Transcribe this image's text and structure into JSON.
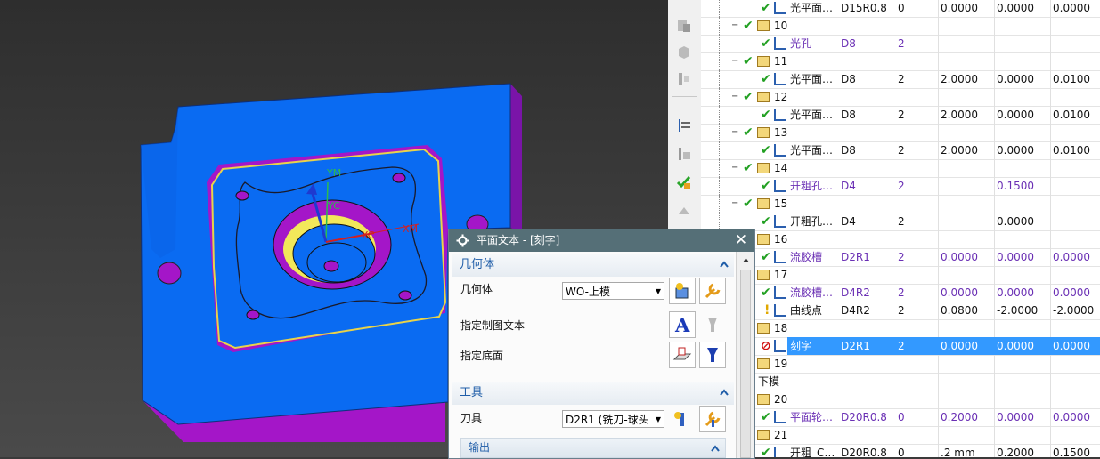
{
  "viewport": {
    "axis_labels": {
      "ym": "YM",
      "yc": "YC",
      "xc": "XC",
      "xm": "XM"
    },
    "colors": {
      "part_blue": "#0a6bf2",
      "part_purple": "#a416c8",
      "background": "#3a3a3a",
      "highlight_yellow": "#f2e85a"
    }
  },
  "navigator": {
    "rows": [
      {
        "name": "光平面…",
        "tool": "D15R0.8",
        "n": "0",
        "a": "0.0000",
        "b": "0.0000",
        "c": "0.0000",
        "kind": "op",
        "icon": "face-mill-icon",
        "status": "ok"
      },
      {
        "name": "10",
        "kind": "group"
      },
      {
        "name": "光孔",
        "tool": "D8",
        "n": "2",
        "a": "",
        "b": "",
        "c": "",
        "kind": "op",
        "purple": true,
        "icon": "drill-icon",
        "status": "ok"
      },
      {
        "name": "11",
        "kind": "group"
      },
      {
        "name": "光平面…",
        "tool": "D8",
        "n": "2",
        "a": "2.0000",
        "b": "0.0000",
        "c": "0.0100",
        "kind": "op",
        "icon": "face-mill-icon",
        "status": "ok"
      },
      {
        "name": "12",
        "kind": "group"
      },
      {
        "name": "光平面…",
        "tool": "D8",
        "n": "2",
        "a": "2.0000",
        "b": "0.0000",
        "c": "0.0100",
        "kind": "op",
        "icon": "face-mill-icon",
        "status": "ok"
      },
      {
        "name": "13",
        "kind": "group"
      },
      {
        "name": "光平面…",
        "tool": "D8",
        "n": "2",
        "a": "2.0000",
        "b": "0.0000",
        "c": "0.0100",
        "kind": "op",
        "icon": "face-mill-icon",
        "status": "ok"
      },
      {
        "name": "14",
        "kind": "group"
      },
      {
        "name": "开粗孔…",
        "tool": "D4",
        "n": "2",
        "a": "",
        "b": "0.1500",
        "c": "",
        "kind": "op",
        "purple": true,
        "icon": "drill-icon",
        "status": "ok"
      },
      {
        "name": "15",
        "kind": "group"
      },
      {
        "name": "开粗孔…",
        "tool": "D4",
        "n": "2",
        "a": "",
        "b": "0.0000",
        "c": "",
        "kind": "op",
        "icon": "drill-icon",
        "status": "ok"
      },
      {
        "name": "16",
        "kind": "group"
      },
      {
        "name": "流胶槽",
        "tool": "D2R1",
        "n": "2",
        "a": "0.0000",
        "b": "0.0000",
        "c": "0.0000",
        "kind": "op",
        "purple": true,
        "icon": "planar-mill-icon",
        "status": "ok"
      },
      {
        "name": "17",
        "kind": "group"
      },
      {
        "name": "流胶槽…",
        "tool": "D4R2",
        "n": "2",
        "a": "0.0000",
        "b": "0.0000",
        "c": "0.0000",
        "kind": "op",
        "purple": true,
        "icon": "planar-mill-icon",
        "status": "ok"
      },
      {
        "name": "曲线点",
        "tool": "D4R2",
        "n": "2",
        "a": "0.0800",
        "b": "-2.0000",
        "c": "-2.0000",
        "kind": "op",
        "icon": "contour-icon",
        "status": "warn"
      },
      {
        "name": "18",
        "kind": "group"
      },
      {
        "name": "刻字",
        "tool": "D2R1",
        "n": "2",
        "a": "0.0000",
        "b": "0.0000",
        "c": "0.0000",
        "kind": "op",
        "icon": "planar-mill-icon",
        "status": "error",
        "selected": true
      },
      {
        "name": "19",
        "kind": "group"
      },
      {
        "name": "下模",
        "kind": "root"
      },
      {
        "name": "20",
        "kind": "group"
      },
      {
        "name": "平面轮…",
        "tool": "D20R0.8",
        "n": "0",
        "a": "0.2000",
        "b": "0.0000",
        "c": "0.0000",
        "kind": "op",
        "purple": true,
        "icon": "planar-mill-icon",
        "status": "ok"
      },
      {
        "name": "21",
        "kind": "group"
      },
      {
        "name": "开粗_C…",
        "tool": "D20R0.8",
        "n": "0",
        "a": ".2 mm",
        "b": "0.2000",
        "c": "0.1500",
        "kind": "op",
        "icon": "cavity-mill-icon",
        "status": "ok"
      }
    ]
  },
  "dialog": {
    "title": "平面文本 - [刻字]",
    "geometry_section": "几何体",
    "geometry_label": "几何体",
    "geometry_value": "WO-上模",
    "drawing_text_label": "指定制图文本",
    "floor_label": "指定底面",
    "tool_section": "工具",
    "tool_label": "刀具",
    "tool_value": "D2R1 (铣刀-球头",
    "output_section": "输出"
  }
}
